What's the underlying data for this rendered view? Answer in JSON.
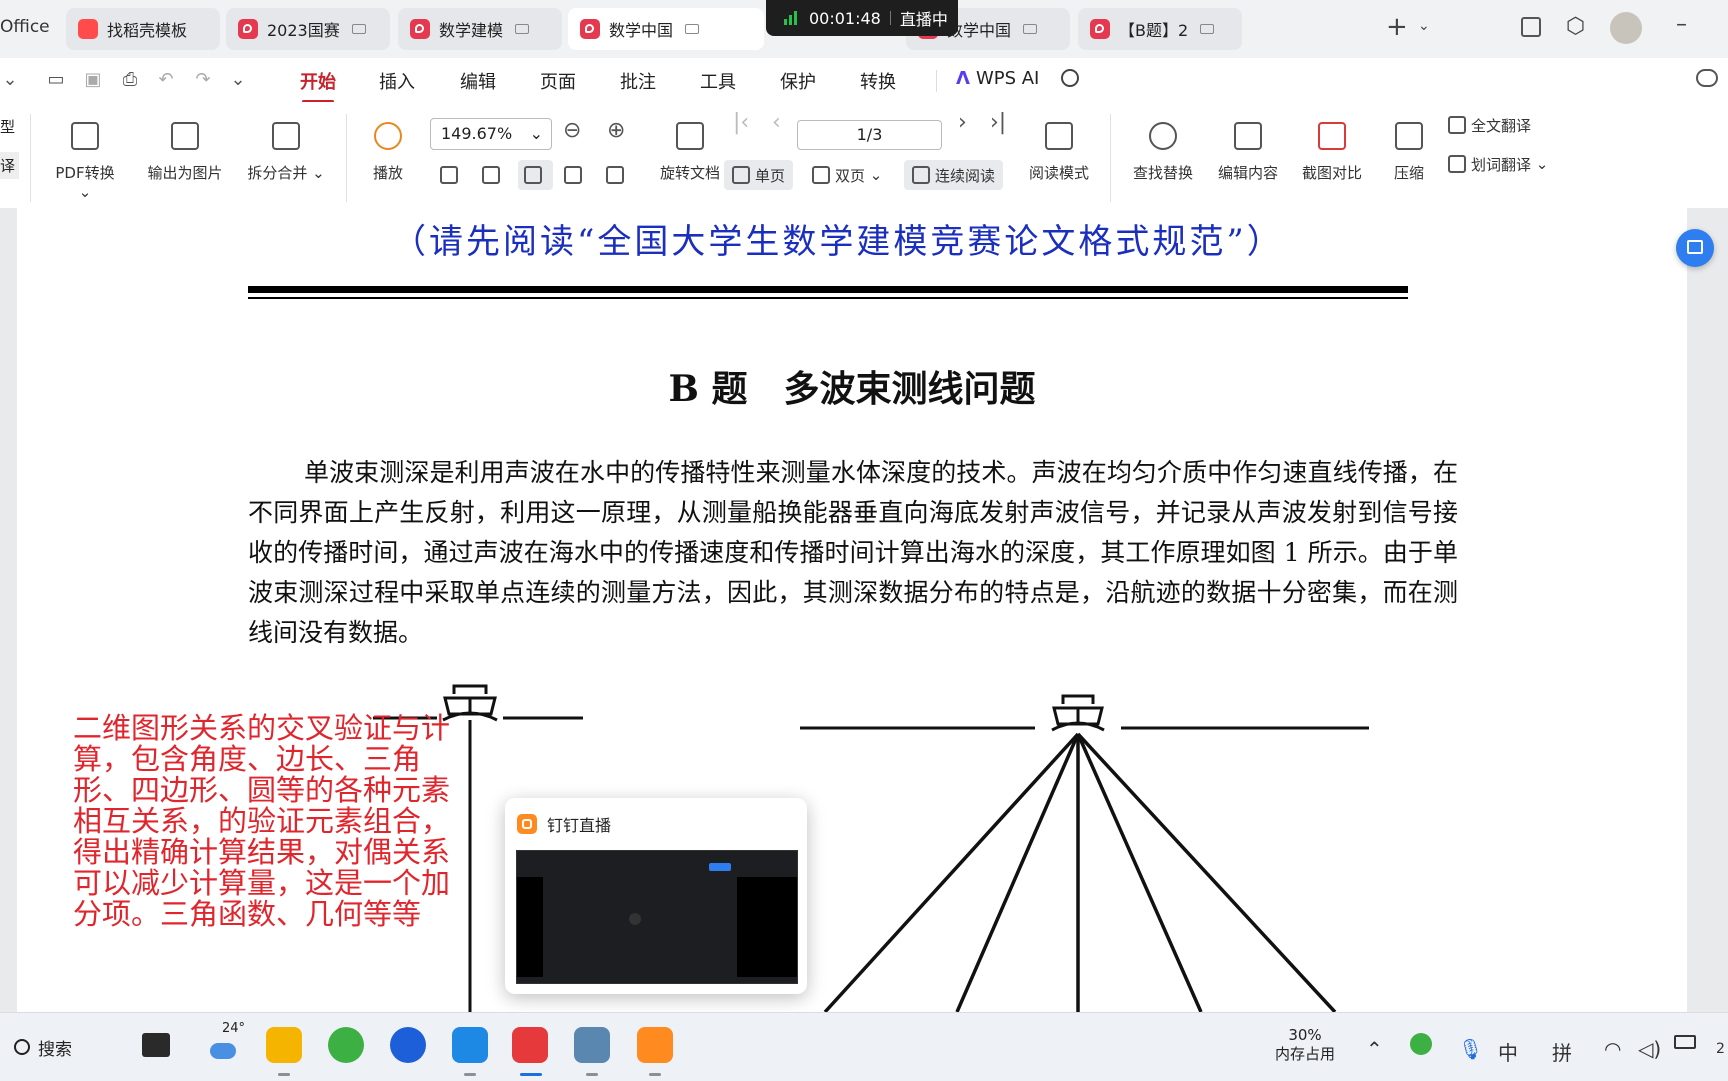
{
  "tabs": {
    "office_label": "Office",
    "items": [
      {
        "label": "找稻壳模板",
        "icon": "template-icon"
      },
      {
        "label": "2023国赛",
        "icon": "pdf-icon"
      },
      {
        "label": "数学建模",
        "icon": "pdf-icon"
      },
      {
        "label": "数学中国",
        "icon": "pdf-icon"
      },
      {
        "label": "数学中国",
        "icon": "pdf-icon"
      },
      {
        "label": "【B题】2",
        "icon": "pdf-icon"
      }
    ],
    "new_tab": "+",
    "live": {
      "timer": "00:01:48",
      "status": "直播中"
    }
  },
  "menu": {
    "items": [
      "开始",
      "插入",
      "编辑",
      "页面",
      "批注",
      "工具",
      "保护",
      "转换"
    ],
    "active": "开始",
    "wps_ai": "WPS AI"
  },
  "toolbar": {
    "pdf_convert": "PDF转换",
    "export_image": "输出为图片",
    "split_merge": "拆分合并",
    "play": "播放",
    "zoom": "149.67%",
    "page": "1/3",
    "rotate_doc": "旋转文档",
    "single_page": "单页",
    "double_page": "双页",
    "continuous": "连续阅读",
    "read_mode": "阅读模式",
    "find_replace": "查找替换",
    "edit_content": "编辑内容",
    "screenshot_compare": "截图对比",
    "compress": "压缩",
    "full_translate": "全文翻译",
    "word_translate": "划词翻译",
    "left_cut_1": "型",
    "left_cut_2": "译"
  },
  "document": {
    "subtitle": "（请先阅读“全国大学生数学建模竞赛论文格式规范”）",
    "title": "B 题　多波束测线问题",
    "paragraph": "单波束测深是利用声波在水中的传播特性来测量水体深度的技术。声波在均匀介质中作匀速直线传播，在不同界面上产生反射，利用这一原理，从测量船换能器垂直向海底发射声波信号，并记录从声波发射到信号接收的传播时间，通过声波在海水中的传播速度和传播时间计算出海水的深度，其工作原理如图 1 所示。由于单波束测深过程中采取单点连续的测量方法，因此，其测深数据分布的特点是，沿航迹的数据十分密集，而在测线间没有数据。",
    "annotation": "二维图形关系的交叉验证与计算，包含角度、边长、三角形、四边形、圆等的各种元素相互关系，的验证元素组合，得出精确计算结果，对偶关系可以减少计算量，这是一个加分项。三角函数、几何等等"
  },
  "popup": {
    "title": "钉钉直播"
  },
  "taskbar": {
    "search": "搜索",
    "weather": "24°",
    "memory_pct": "30%",
    "memory_label": "内存占用",
    "ime_lang": "中",
    "ime_mode": "拼",
    "edge_digit": "2"
  }
}
